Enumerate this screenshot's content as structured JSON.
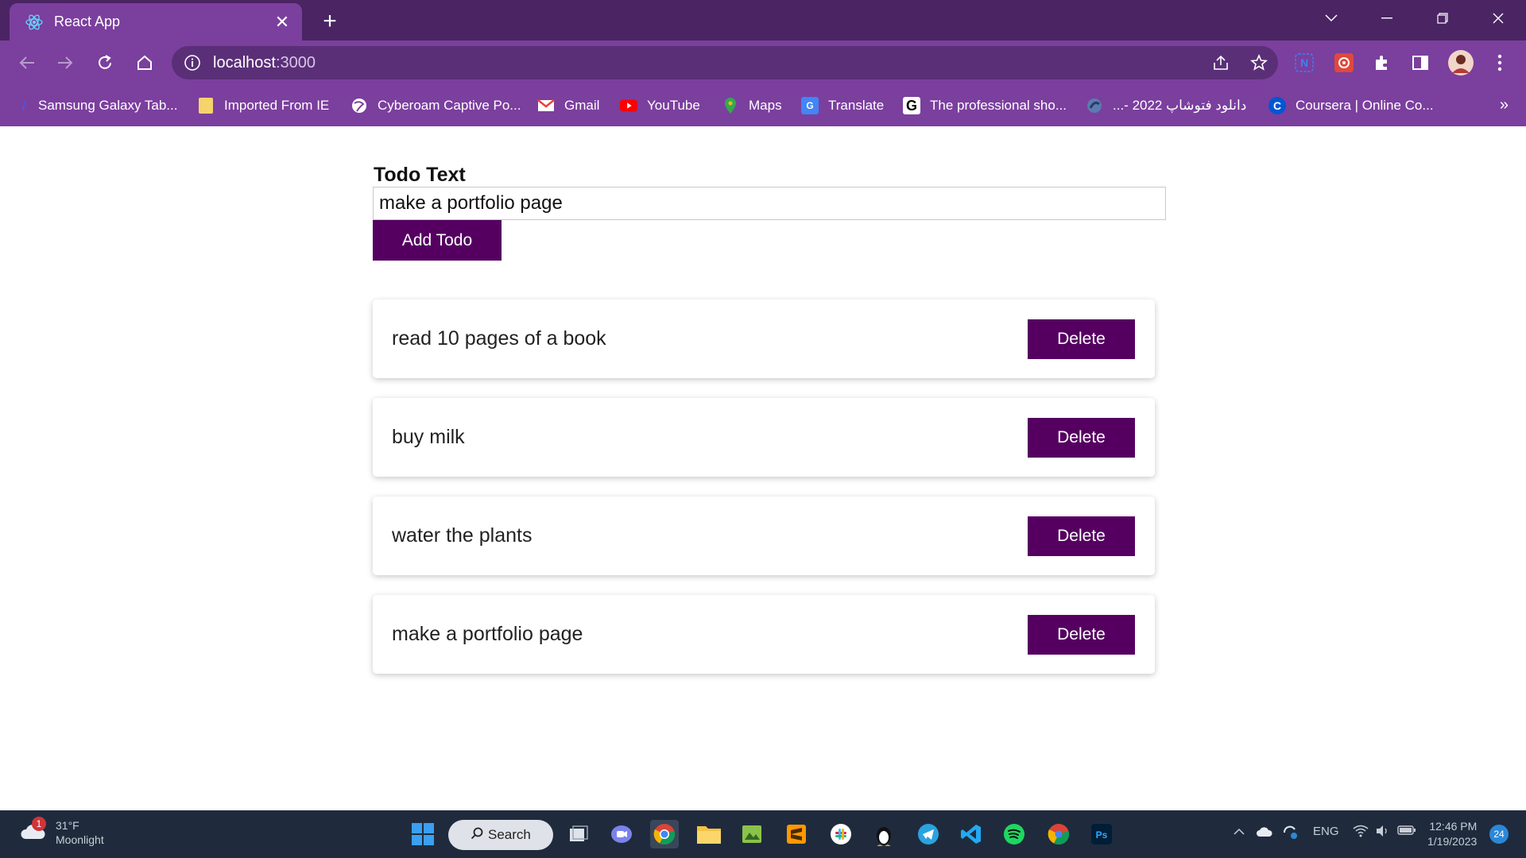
{
  "browser": {
    "tab": {
      "title": "React App",
      "favicon": "react-logo-icon"
    },
    "address": {
      "host": "localhost",
      "port": ":3000"
    },
    "bookmarks": [
      {
        "label": "Samsung Galaxy Tab...",
        "icon": "samsung-icon"
      },
      {
        "label": "Imported From IE",
        "icon": "folder-icon"
      },
      {
        "label": "Cyberoam Captive Po...",
        "icon": "globe-icon"
      },
      {
        "label": "Gmail",
        "icon": "gmail-icon"
      },
      {
        "label": "YouTube",
        "icon": "youtube-icon"
      },
      {
        "label": "Maps",
        "icon": "maps-icon"
      },
      {
        "label": "Translate",
        "icon": "translate-icon"
      },
      {
        "label": "The professional sho...",
        "icon": "g-logo-icon"
      },
      {
        "label": "دانلود فتوشاپ 2022 -...",
        "icon": "photoshop-bird-icon"
      },
      {
        "label": "Coursera | Online Co...",
        "icon": "coursera-icon"
      }
    ]
  },
  "form": {
    "label": "Todo Text",
    "input_value": "make a portfolio page",
    "add_button": "Add Todo"
  },
  "todos": [
    {
      "text": "read 10 pages of a book",
      "delete_label": "Delete"
    },
    {
      "text": "buy milk",
      "delete_label": "Delete"
    },
    {
      "text": "water the plants",
      "delete_label": "Delete"
    },
    {
      "text": "make a portfolio page",
      "delete_label": "Delete"
    }
  ],
  "taskbar": {
    "weather": {
      "temp": "31°F",
      "condition": "Moonlight",
      "badge": "1"
    },
    "search_label": "Search",
    "language": "ENG",
    "time": "12:46 PM",
    "date": "1/19/2023",
    "notifications": "24"
  },
  "colors": {
    "accent": "#550061",
    "chrome_dark": "#4a2463",
    "chrome": "#7b3f9e",
    "taskbar": "#1f2b3d"
  }
}
